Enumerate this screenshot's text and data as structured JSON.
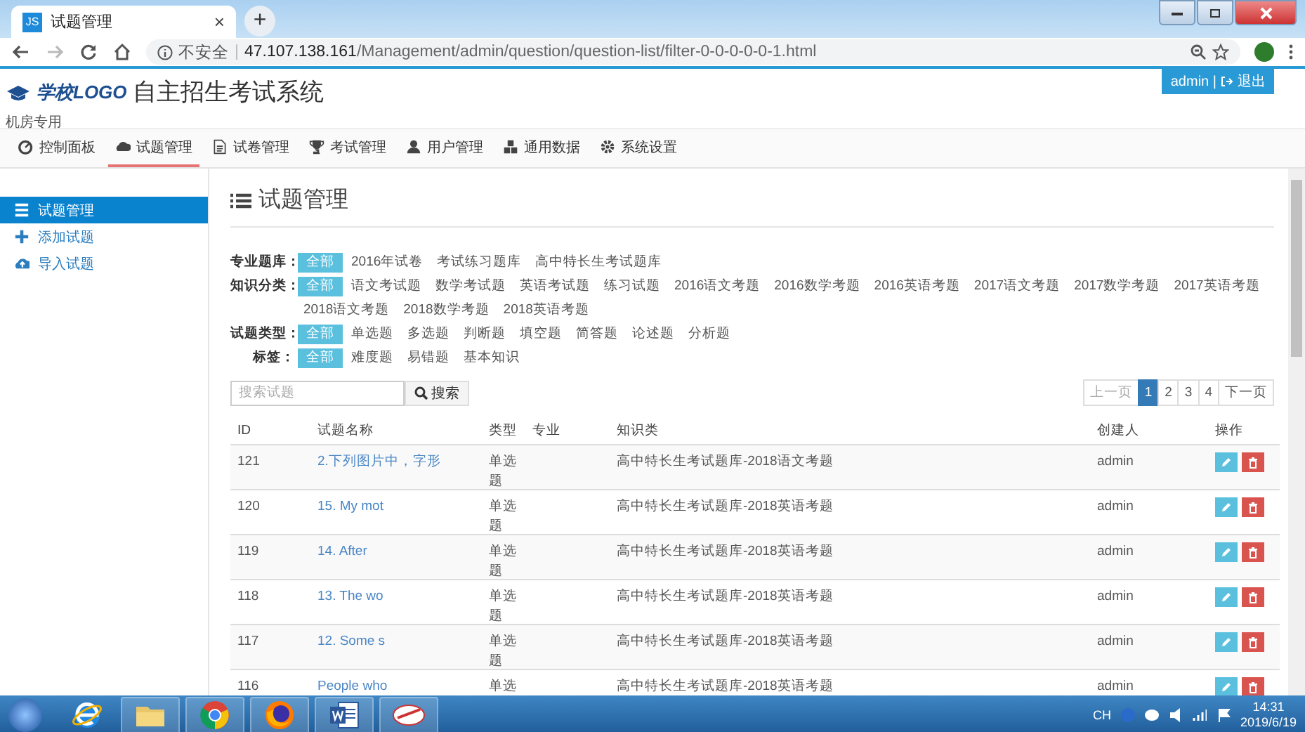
{
  "browser": {
    "tab_icon": "JS",
    "tab_title": "试题管理",
    "tab_close": "×",
    "new_tab": "+",
    "security": "不安全",
    "url_separator": "|",
    "url_host": "47.107.138.161",
    "url_path": "/Management/admin/question/question-list/filter-0-0-0-0-0-1.html"
  },
  "header": {
    "logo": "学校LOGO",
    "title": "自主招生考试系统",
    "subtitle": "机房专用",
    "user": "admin",
    "separator": "|",
    "logout": "退出"
  },
  "nav": [
    {
      "label": "控制面板",
      "selected": false
    },
    {
      "label": "试题管理",
      "selected": true
    },
    {
      "label": "试卷管理",
      "selected": false
    },
    {
      "label": "考试管理",
      "selected": false
    },
    {
      "label": "用户管理",
      "selected": false
    },
    {
      "label": "通用数据",
      "selected": false
    },
    {
      "label": "系统设置",
      "selected": false
    }
  ],
  "sidebar": [
    {
      "label": "试题管理",
      "selected": true
    },
    {
      "label": "添加试题",
      "selected": false
    },
    {
      "label": "导入试题",
      "selected": false
    }
  ],
  "page_title": "试题管理",
  "filters": [
    {
      "label": "专业题库：",
      "options": [
        {
          "label": "全部",
          "selected": true
        },
        {
          "label": "2016年试卷",
          "selected": false
        },
        {
          "label": "考试练习题库",
          "selected": false
        },
        {
          "label": "高中特长生考试题库",
          "selected": false
        }
      ]
    },
    {
      "label": "知识分类：",
      "options": [
        {
          "label": "全部",
          "selected": true
        },
        {
          "label": "语文考试题",
          "selected": false
        },
        {
          "label": "数学考试题",
          "selected": false
        },
        {
          "label": "英语考试题",
          "selected": false
        },
        {
          "label": "练习试题",
          "selected": false
        },
        {
          "label": "2016语文考题",
          "selected": false
        },
        {
          "label": "2016数学考题",
          "selected": false
        },
        {
          "label": "2016英语考题",
          "selected": false
        },
        {
          "label": "2017语文考题",
          "selected": false
        },
        {
          "label": "2017数学考题",
          "selected": false
        },
        {
          "label": "2017英语考题",
          "selected": false
        },
        {
          "label": "2018语文考题",
          "selected": false
        },
        {
          "label": "2018数学考题",
          "selected": false
        },
        {
          "label": "2018英语考题",
          "selected": false
        }
      ]
    },
    {
      "label": "试题类型：",
      "options": [
        {
          "label": "全部",
          "selected": true
        },
        {
          "label": "单选题",
          "selected": false
        },
        {
          "label": "多选题",
          "selected": false
        },
        {
          "label": "判断题",
          "selected": false
        },
        {
          "label": "填空题",
          "selected": false
        },
        {
          "label": "简答题",
          "selected": false
        },
        {
          "label": "论述题",
          "selected": false
        },
        {
          "label": "分析题",
          "selected": false
        }
      ]
    },
    {
      "label": "标签：",
      "options": [
        {
          "label": "全部",
          "selected": true
        },
        {
          "label": "难度题",
          "selected": false
        },
        {
          "label": "易错题",
          "selected": false
        },
        {
          "label": "基本知识",
          "selected": false
        }
      ]
    }
  ],
  "search": {
    "placeholder": "搜索试题",
    "button": "搜索"
  },
  "pagination": [
    {
      "label": "上一页",
      "selected": false,
      "disabled": true
    },
    {
      "label": "1",
      "selected": true,
      "disabled": false
    },
    {
      "label": "2",
      "selected": false,
      "disabled": false
    },
    {
      "label": "3",
      "selected": false,
      "disabled": false
    },
    {
      "label": "4",
      "selected": false,
      "disabled": false
    },
    {
      "label": "下一页",
      "selected": false,
      "disabled": false
    }
  ],
  "table": {
    "columns": [
      "ID",
      "试题名称",
      "类型",
      "专业",
      "知识类",
      "创建人",
      "操作"
    ],
    "rows": [
      {
        "id": "121",
        "name": "2.下列图片中，字形",
        "type": "单选题",
        "knowledge": "高中特长生考试题库-2018语文考题",
        "creator": "admin"
      },
      {
        "id": "120",
        "name": "15. My mot",
        "type": "单选题",
        "knowledge": "高中特长生考试题库-2018英语考题",
        "creator": "admin"
      },
      {
        "id": "119",
        "name": "14. After",
        "type": "单选题",
        "knowledge": "高中特长生考试题库-2018英语考题",
        "creator": "admin"
      },
      {
        "id": "118",
        "name": "13. The wo",
        "type": "单选题",
        "knowledge": "高中特长生考试题库-2018英语考题",
        "creator": "admin"
      },
      {
        "id": "117",
        "name": "12. Some s",
        "type": "单选题",
        "knowledge": "高中特长生考试题库-2018英语考题",
        "creator": "admin"
      },
      {
        "id": "116",
        "name": "People who",
        "type": "单选",
        "knowledge": "高中特长生考试题库-2018英语考题",
        "creator": "admin"
      }
    ]
  },
  "taskbar": {
    "tray_language": "CH",
    "time": "14:31",
    "date": "2019/6/19"
  }
}
